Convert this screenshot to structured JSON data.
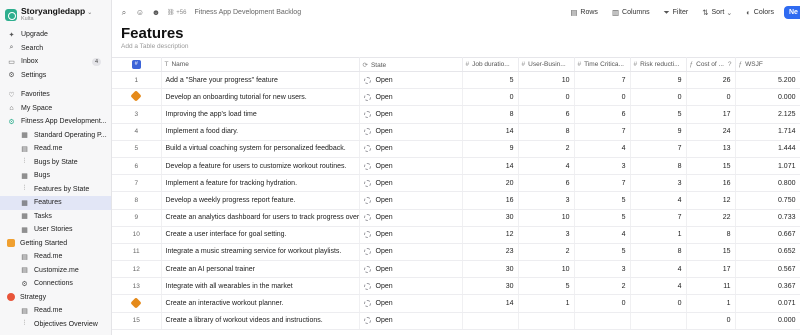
{
  "workspace": {
    "name": "Storyangledapp",
    "user": "Kulta"
  },
  "nav": {
    "upgrade": "Upgrade",
    "search": "Search",
    "inbox": "Inbox",
    "inbox_count": "4",
    "settings": "Settings",
    "favorites": "Favorites",
    "my_space": "My Space"
  },
  "tree": [
    {
      "label": "Fitness App Development...",
      "level": 0,
      "icon": "folder-icon"
    },
    {
      "label": "Standard Operating P...",
      "level": 1,
      "icon": "table-icon"
    },
    {
      "label": "Read.me",
      "level": 1,
      "icon": "doc-icon"
    },
    {
      "label": "Bugs by State",
      "level": 1,
      "icon": "board-icon"
    },
    {
      "label": "Bugs",
      "level": 1,
      "icon": "table-icon"
    },
    {
      "label": "Features by State",
      "level": 1,
      "icon": "board-icon"
    },
    {
      "label": "Features",
      "level": 1,
      "icon": "table-icon",
      "active": true
    },
    {
      "label": "Tasks",
      "level": 1,
      "icon": "table-icon"
    },
    {
      "label": "User Stories",
      "level": 1,
      "icon": "table-icon"
    },
    {
      "label": "Getting Started",
      "level": 0,
      "icon": "folder-orange-icon"
    },
    {
      "label": "Read.me",
      "level": 1,
      "icon": "doc-icon"
    },
    {
      "label": "Customize.me",
      "level": 1,
      "icon": "doc-icon"
    },
    {
      "label": "Connections",
      "level": 1,
      "icon": "link-icon"
    },
    {
      "label": "Strategy",
      "level": 0,
      "icon": "target-icon"
    },
    {
      "label": "Read.me",
      "level": 1,
      "icon": "doc-icon"
    },
    {
      "label": "Objectives Overview",
      "level": 1,
      "icon": "board-icon"
    }
  ],
  "topbar": {
    "count": "+56",
    "breadcrumb": "Fitness App Development Backlog",
    "rows": "Rows",
    "columns": "Columns",
    "filter": "Filter",
    "sort": "Sort",
    "colors": "Colors",
    "new": "Ne"
  },
  "page": {
    "title": "Features",
    "description": "Add a Table description"
  },
  "columns": {
    "name": "Name",
    "state": "State",
    "job": "Job duratio...",
    "ub": "User-Busin...",
    "tc": "Time Critica...",
    "rr": "Risk reducti...",
    "cost": "Cost of ...",
    "wsjf": "WSJF"
  },
  "rows": [
    {
      "idx": "1",
      "name": "Add a \"Share your progress\" feature",
      "state": "Open",
      "job": "5",
      "ub": "10",
      "tc": "7",
      "rr": "9",
      "cost": "26",
      "wsjf": "5.200"
    },
    {
      "idx": "",
      "flag": true,
      "name": "Develop an onboarding tutorial for new users.",
      "state": "Open",
      "job": "0",
      "ub": "0",
      "tc": "0",
      "rr": "0",
      "cost": "0",
      "wsjf": "0.000"
    },
    {
      "idx": "3",
      "name": "Improving the app's load time",
      "state": "Open",
      "job": "8",
      "ub": "6",
      "tc": "6",
      "rr": "5",
      "cost": "17",
      "wsjf": "2.125"
    },
    {
      "idx": "4",
      "name": "Implement a food diary.",
      "state": "Open",
      "job": "14",
      "ub": "8",
      "tc": "7",
      "rr": "9",
      "cost": "24",
      "wsjf": "1.714"
    },
    {
      "idx": "5",
      "name": "Build a virtual coaching system for personalized feedback.",
      "state": "Open",
      "job": "9",
      "ub": "2",
      "tc": "4",
      "rr": "7",
      "cost": "13",
      "wsjf": "1.444"
    },
    {
      "idx": "6",
      "name": "Develop a feature for users to customize workout routines.",
      "state": "Open",
      "job": "14",
      "ub": "4",
      "tc": "3",
      "rr": "8",
      "cost": "15",
      "wsjf": "1.071"
    },
    {
      "idx": "7",
      "name": "Implement a feature for tracking hydration.",
      "state": "Open",
      "job": "20",
      "ub": "6",
      "tc": "7",
      "rr": "3",
      "cost": "16",
      "wsjf": "0.800"
    },
    {
      "idx": "8",
      "name": "Develop a weekly progress report feature.",
      "state": "Open",
      "job": "16",
      "ub": "3",
      "tc": "5",
      "rr": "4",
      "cost": "12",
      "wsjf": "0.750"
    },
    {
      "idx": "9",
      "name": "Create an analytics dashboard for users to track progress over ti",
      "state": "Open",
      "job": "30",
      "ub": "10",
      "tc": "5",
      "rr": "7",
      "cost": "22",
      "wsjf": "0.733"
    },
    {
      "idx": "10",
      "name": "Create a user interface for goal setting.",
      "state": "Open",
      "job": "12",
      "ub": "3",
      "tc": "4",
      "rr": "1",
      "cost": "8",
      "wsjf": "0.667"
    },
    {
      "idx": "11",
      "name": "Integrate a music streaming service for workout playlists.",
      "state": "Open",
      "job": "23",
      "ub": "2",
      "tc": "5",
      "rr": "8",
      "cost": "15",
      "wsjf": "0.652"
    },
    {
      "idx": "12",
      "name": "Create an AI personal trainer",
      "state": "Open",
      "job": "30",
      "ub": "10",
      "tc": "3",
      "rr": "4",
      "cost": "17",
      "wsjf": "0.567"
    },
    {
      "idx": "13",
      "name": "Integrate with all wearables in the market",
      "state": "Open",
      "job": "30",
      "ub": "5",
      "tc": "2",
      "rr": "4",
      "cost": "11",
      "wsjf": "0.367"
    },
    {
      "idx": "",
      "flag": true,
      "name": "Create an interactive workout planner.",
      "state": "Open",
      "job": "14",
      "ub": "1",
      "tc": "0",
      "rr": "0",
      "cost": "1",
      "wsjf": "0.071"
    },
    {
      "idx": "15",
      "name": "Create a library of workout videos and instructions.",
      "state": "Open",
      "job": "",
      "ub": "",
      "tc": "",
      "rr": "",
      "cost": "0",
      "wsjf": "0.000"
    }
  ]
}
